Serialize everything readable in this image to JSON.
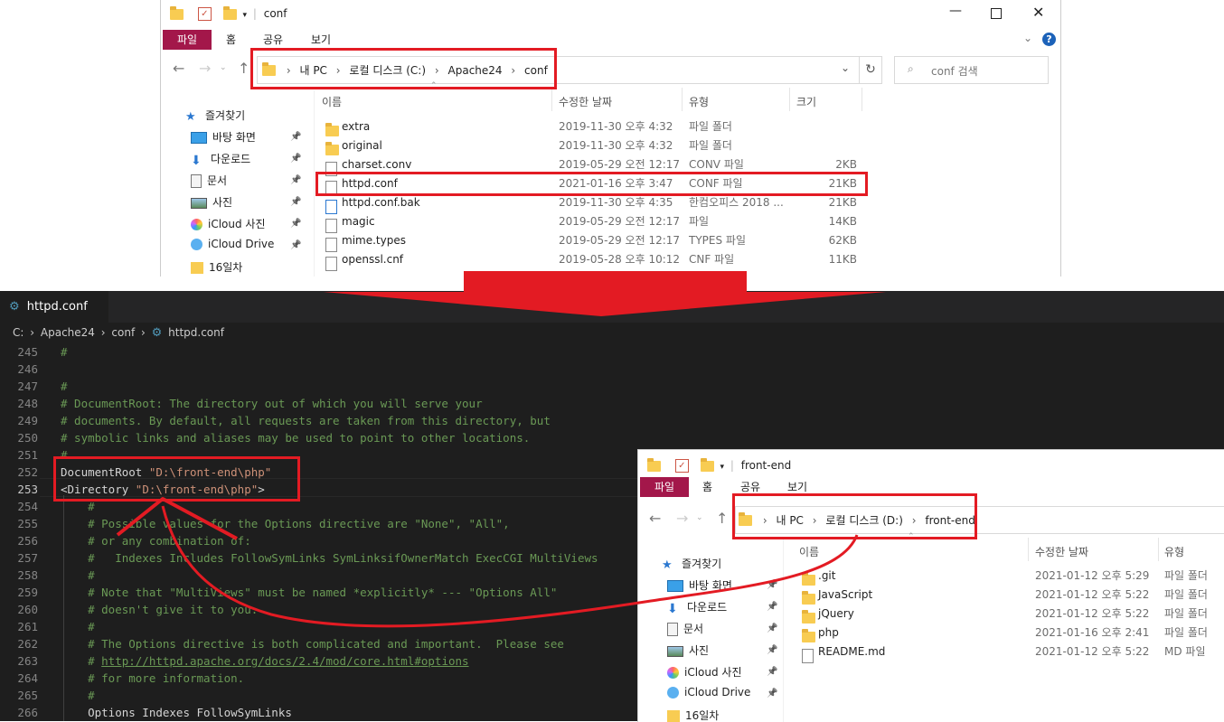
{
  "explorer1": {
    "title": "conf",
    "ribbon": {
      "file": "파일",
      "home": "홈",
      "share": "공유",
      "view": "보기"
    },
    "address": {
      "crumbs": [
        "내 PC",
        "로컬 디스크 (C:)",
        "Apache24",
        "conf"
      ]
    },
    "search_placeholder": "conf 검색",
    "columns": {
      "name": "이름",
      "date": "수정한 날짜",
      "type": "유형",
      "size": "크기"
    },
    "sidebar": [
      {
        "label": "즐겨찾기",
        "icon": "star-icon"
      },
      {
        "label": "바탕 화면",
        "icon": "desktop-icon"
      },
      {
        "label": "다운로드",
        "icon": "download-icon"
      },
      {
        "label": "문서",
        "icon": "document-icon"
      },
      {
        "label": "사진",
        "icon": "pictures-icon"
      },
      {
        "label": "iCloud 사진",
        "icon": "icloud-photos-icon"
      },
      {
        "label": "iCloud Drive",
        "icon": "icloud-drive-icon"
      },
      {
        "label": "16일차",
        "icon": "folder-icon"
      }
    ],
    "files": [
      {
        "name": "extra",
        "date": "2019-11-30 오후 4:32",
        "type": "파일 폴더",
        "size": "",
        "icon": "folder-icon"
      },
      {
        "name": "original",
        "date": "2019-11-30 오후 4:32",
        "type": "파일 폴더",
        "size": "",
        "icon": "folder-icon"
      },
      {
        "name": "charset.conv",
        "date": "2019-05-29 오전 12:17",
        "type": "CONV 파일",
        "size": "2KB",
        "icon": "file-icon"
      },
      {
        "name": "httpd.conf",
        "date": "2021-01-16 오후 3:47",
        "type": "CONF 파일",
        "size": "21KB",
        "icon": "file-icon"
      },
      {
        "name": "httpd.conf.bak",
        "date": "2019-11-30 오후 4:35",
        "type": "한컴오피스 2018 ...",
        "size": "21KB",
        "icon": "hancom-file-icon"
      },
      {
        "name": "magic",
        "date": "2019-05-29 오전 12:17",
        "type": "파일",
        "size": "14KB",
        "icon": "file-icon"
      },
      {
        "name": "mime.types",
        "date": "2019-05-29 오전 12:17",
        "type": "TYPES 파일",
        "size": "62KB",
        "icon": "file-icon"
      },
      {
        "name": "openssl.cnf",
        "date": "2019-05-28 오후 10:12",
        "type": "CNF 파일",
        "size": "11KB",
        "icon": "file-icon"
      }
    ]
  },
  "editor": {
    "tab_label": "httpd.conf",
    "breadcrumb": [
      "C:",
      "Apache24",
      "conf",
      "httpd.conf"
    ],
    "lines": [
      {
        "n": "245",
        "text": "#",
        "kind": "cmt"
      },
      {
        "n": "246",
        "text": "",
        "kind": "cmt"
      },
      {
        "n": "247",
        "text": "#",
        "kind": "cmt"
      },
      {
        "n": "248",
        "text": "# DocumentRoot: The directory out of which you will serve your",
        "kind": "cmt"
      },
      {
        "n": "249",
        "text": "# documents. By default, all requests are taken from this directory, but",
        "kind": "cmt"
      },
      {
        "n": "250",
        "text": "# symbolic links and aliases may be used to point to other locations.",
        "kind": "cmt"
      },
      {
        "n": "251",
        "text": "#",
        "kind": "cmt"
      },
      {
        "n": "252",
        "kw": "DocumentRoot ",
        "str": "\"D:\\front-end\\php\"",
        "kind": "mix"
      },
      {
        "n": "253",
        "kw": "<Directory ",
        "str": "\"D:\\front-end\\php\"",
        "tail": ">",
        "kind": "mix"
      },
      {
        "n": "254",
        "text": "    #",
        "kind": "cmt"
      },
      {
        "n": "255",
        "text": "    # Possible values for the Options directive are \"None\", \"All\",",
        "kind": "cmt"
      },
      {
        "n": "256",
        "text": "    # or any combination of:",
        "kind": "cmt"
      },
      {
        "n": "257",
        "text": "    #   Indexes Includes FollowSymLinks SymLinksifOwnerMatch ExecCGI MultiViews",
        "kind": "cmt"
      },
      {
        "n": "258",
        "text": "    #",
        "kind": "cmt"
      },
      {
        "n": "259",
        "text": "    # Note that \"MultiViews\" must be named *explicitly* --- \"Options All\"",
        "kind": "cmt"
      },
      {
        "n": "260",
        "text": "    # doesn't give it to you.",
        "kind": "cmt"
      },
      {
        "n": "261",
        "text": "    #",
        "kind": "cmt"
      },
      {
        "n": "262",
        "text": "    # The Options directive is both complicated and important.  Please see",
        "kind": "cmt"
      },
      {
        "n": "263",
        "pre": "    # ",
        "link": "http://httpd.apache.org/docs/2.4/mod/core.html#options",
        "kind": "link"
      },
      {
        "n": "264",
        "text": "    # for more information.",
        "kind": "cmt"
      },
      {
        "n": "265",
        "text": "    #",
        "kind": "cmt"
      },
      {
        "n": "266",
        "kw": "    Options Indexes FollowSymLinks",
        "kind": "kw"
      }
    ]
  },
  "explorer2": {
    "title": "front-end",
    "ribbon": {
      "file": "파일",
      "home": "홈",
      "share": "공유",
      "view": "보기"
    },
    "address": {
      "crumbs": [
        "내 PC",
        "로컬 디스크 (D:)",
        "front-end"
      ]
    },
    "columns": {
      "name": "이름",
      "date": "수정한 날짜",
      "type": "유형"
    },
    "sidebar": [
      {
        "label": "즐겨찾기",
        "icon": "star-icon"
      },
      {
        "label": "바탕 화면",
        "icon": "desktop-icon"
      },
      {
        "label": "다운로드",
        "icon": "download-icon"
      },
      {
        "label": "문서",
        "icon": "document-icon"
      },
      {
        "label": "사진",
        "icon": "pictures-icon"
      },
      {
        "label": "iCloud 사진",
        "icon": "icloud-photos-icon"
      },
      {
        "label": "iCloud Drive",
        "icon": "icloud-drive-icon"
      },
      {
        "label": "16일차",
        "icon": "folder-icon"
      }
    ],
    "files": [
      {
        "name": ".git",
        "date": "2021-01-12 오후 5:29",
        "type": "파일 폴더",
        "icon": "folder-icon"
      },
      {
        "name": "JavaScript",
        "date": "2021-01-12 오후 5:22",
        "type": "파일 폴더",
        "icon": "folder-icon"
      },
      {
        "name": "jQuery",
        "date": "2021-01-12 오후 5:22",
        "type": "파일 폴더",
        "icon": "folder-icon"
      },
      {
        "name": "php",
        "date": "2021-01-16 오후 2:41",
        "type": "파일 폴더",
        "icon": "folder-icon"
      },
      {
        "name": "README.md",
        "date": "2021-01-12 오후 5:22",
        "type": "MD 파일",
        "icon": "file-icon"
      }
    ]
  },
  "colors": {
    "annotation_red": "#e31b23",
    "ribbon_file": "#a3174a",
    "editor_bg": "#1e1e1e",
    "comment": "#6a9955",
    "string": "#ce9178"
  }
}
